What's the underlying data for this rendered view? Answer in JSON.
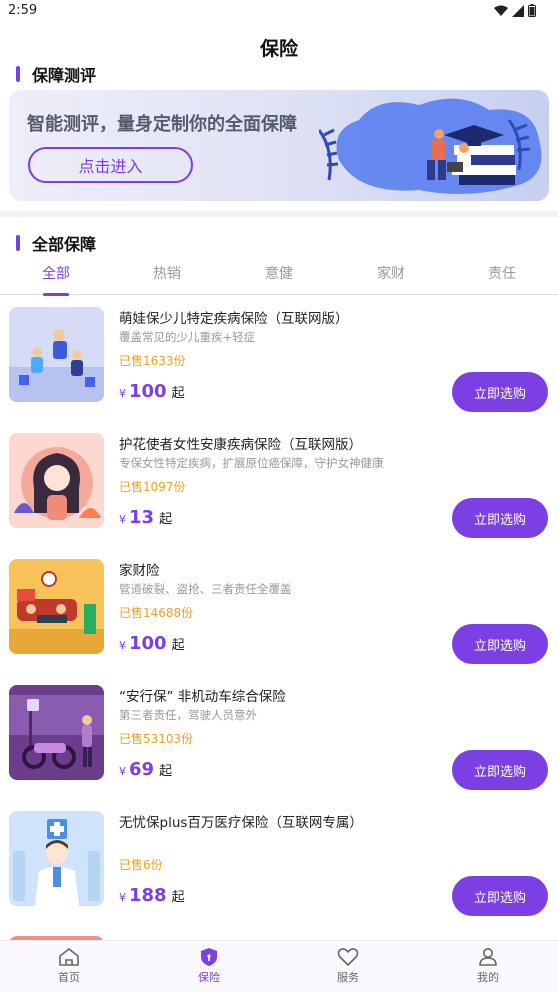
{
  "status_bar": {
    "time": "2:59"
  },
  "app": {
    "title": "保险"
  },
  "assessment": {
    "section_title": "保障测评",
    "banner_text": "智能测评，量身定制你的全面保障",
    "button_label": "点击进入"
  },
  "all_products": {
    "section_title": "全部保障",
    "tabs": [
      {
        "label": "全部"
      },
      {
        "label": "热销"
      },
      {
        "label": "意健"
      },
      {
        "label": "家财"
      },
      {
        "label": "责任"
      }
    ]
  },
  "products": [
    {
      "name": "萌娃保少儿特定疾病保险（互联网版）",
      "desc": "覆盖常见的少儿重疾+轻症",
      "sold": "已售1633份",
      "currency": "¥",
      "price": "100",
      "unit": "起",
      "button": "立即选购"
    },
    {
      "name": "护花使者女性安康疾病保险（互联网版）",
      "desc": "专保女性特定疾病，扩展原位癌保障，守护女神健康",
      "sold": "已售1097份",
      "currency": "¥",
      "price": "13",
      "unit": "起",
      "button": "立即选购"
    },
    {
      "name": "家财险",
      "desc": "管道破裂、盗抢、三者责任全覆盖",
      "sold": "已售14688份",
      "currency": "¥",
      "price": "100",
      "unit": "起",
      "button": "立即选购"
    },
    {
      "name": "“安行保” 非机动车综合保险",
      "desc": "第三者责任，驾驶人员意外",
      "sold": "已售53103份",
      "currency": "¥",
      "price": "69",
      "unit": "起",
      "button": "立即选购"
    },
    {
      "name": "无忧保plus百万医疗保险（互联网专属）",
      "desc": "",
      "sold": "已售6份",
      "currency": "¥",
      "price": "188",
      "unit": "起",
      "button": "立即选购"
    }
  ],
  "bottom_nav": [
    {
      "label": "首页",
      "icon": "home-icon"
    },
    {
      "label": "保险",
      "icon": "shield-icon"
    },
    {
      "label": "服务",
      "icon": "heart-icon"
    },
    {
      "label": "我的",
      "icon": "user-icon"
    }
  ],
  "colors": {
    "accent": "#7b3fe4",
    "sold": "#f0a020"
  }
}
